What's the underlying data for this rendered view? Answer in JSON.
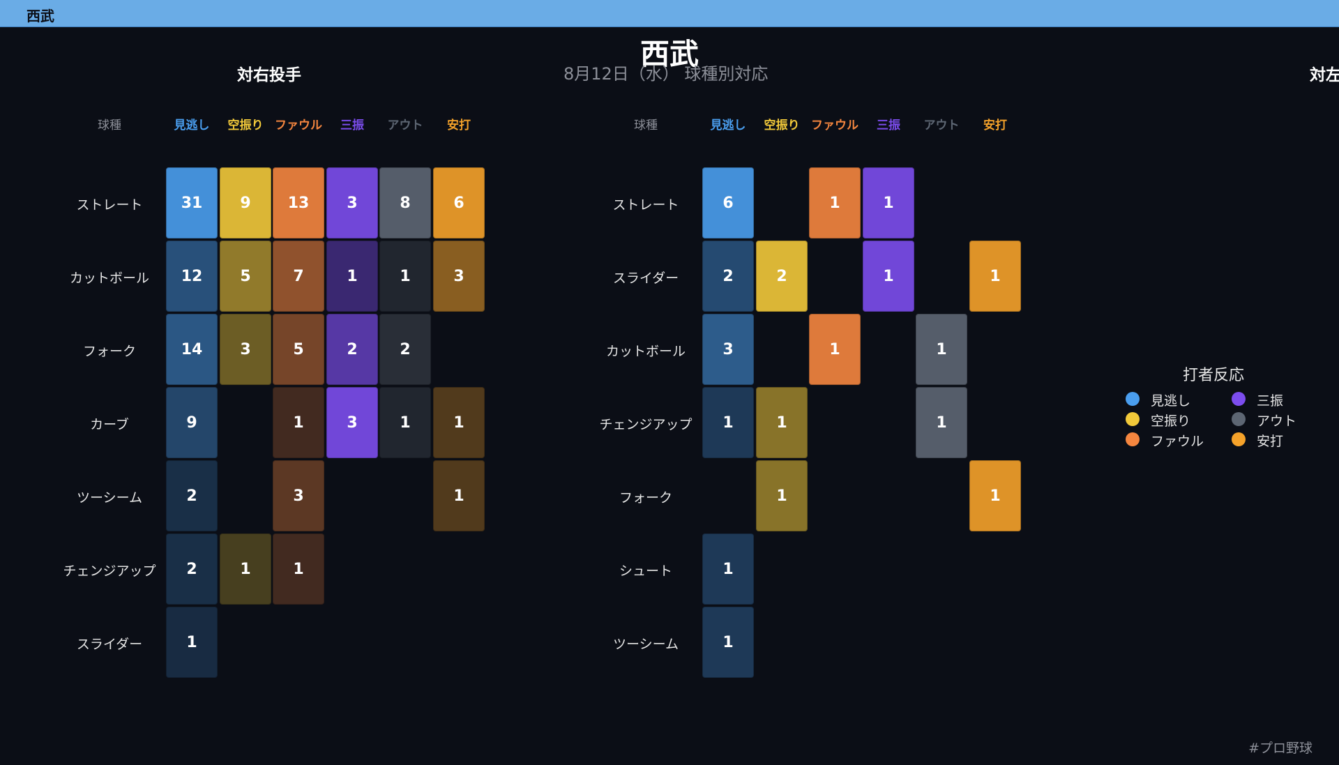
{
  "window_title": "西武",
  "header": {
    "title": "西武",
    "subtitle": "8月12日（水） 球種別対応"
  },
  "hashtag": "#プロ野球",
  "legend": {
    "title": "打者反応",
    "items": [
      {
        "label": "見逃し",
        "color": "#4a9eef"
      },
      {
        "label": "三振",
        "color": "#7c4dee"
      },
      {
        "label": "空振り",
        "color": "#f2c93a"
      },
      {
        "label": "アウト",
        "color": "#5d6673"
      },
      {
        "label": "ファウル",
        "color": "#f5863f"
      },
      {
        "label": "安打",
        "color": "#f5a22a"
      }
    ]
  },
  "chart_data": [
    {
      "type": "heatmap",
      "title": "対右投手",
      "column_header": "球種",
      "columns": [
        "見逃し",
        "空振り",
        "ファウル",
        "三振",
        "アウト",
        "安打"
      ],
      "column_colors": [
        "#4a9eef",
        "#f2c93a",
        "#f5863f",
        "#7c4dee",
        "#5d6673",
        "#f5a22a"
      ],
      "rows": [
        "ストレート",
        "カットボール",
        "フォーク",
        "カーブ",
        "ツーシーム",
        "チェンジアップ",
        "スライダー"
      ],
      "values": [
        [
          31,
          9,
          13,
          3,
          8,
          6
        ],
        [
          12,
          5,
          7,
          1,
          1,
          3
        ],
        [
          14,
          3,
          5,
          2,
          2,
          null
        ],
        [
          9,
          null,
          1,
          3,
          1,
          1
        ],
        [
          2,
          null,
          3,
          null,
          null,
          1
        ],
        [
          2,
          1,
          1,
          null,
          null,
          null
        ],
        [
          1,
          null,
          null,
          null,
          null,
          null
        ]
      ],
      "column_max": [
        31,
        9,
        13,
        3,
        8,
        6
      ]
    },
    {
      "type": "heatmap",
      "title": "対左投手",
      "column_header": "球種",
      "columns": [
        "見逃し",
        "空振り",
        "ファウル",
        "三振",
        "アウト",
        "安打"
      ],
      "column_colors": [
        "#4a9eef",
        "#f2c93a",
        "#f5863f",
        "#7c4dee",
        "#5d6673",
        "#f5a22a"
      ],
      "rows": [
        "ストレート",
        "スライダー",
        "カットボール",
        "チェンジアップ",
        "フォーク",
        "シュート",
        "ツーシーム"
      ],
      "values": [
        [
          6,
          null,
          1,
          1,
          null,
          null
        ],
        [
          2,
          2,
          null,
          1,
          null,
          1
        ],
        [
          3,
          null,
          1,
          null,
          1,
          null
        ],
        [
          1,
          1,
          null,
          null,
          1,
          null
        ],
        [
          null,
          1,
          null,
          null,
          null,
          1
        ],
        [
          1,
          null,
          null,
          null,
          null,
          null
        ],
        [
          1,
          null,
          null,
          null,
          null,
          null
        ]
      ],
      "column_max": [
        6,
        2,
        1,
        1,
        1,
        1
      ]
    }
  ]
}
